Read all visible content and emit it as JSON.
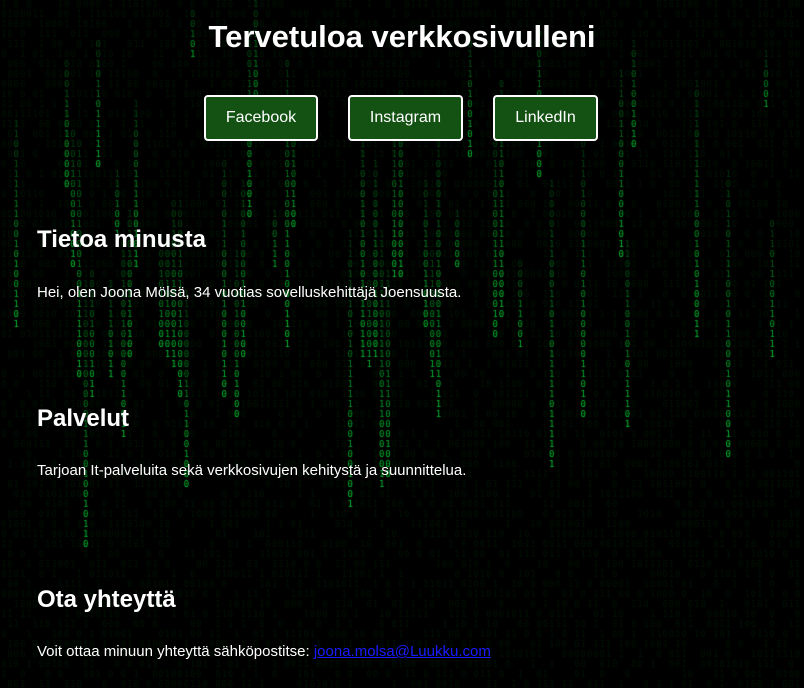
{
  "header": {
    "title": "Tervetuloa verkkosivulleni"
  },
  "nav": {
    "buttons": [
      {
        "label": "Facebook"
      },
      {
        "label": "Instagram"
      },
      {
        "label": "LinkedIn"
      }
    ]
  },
  "sections": {
    "about": {
      "heading": "Tietoa minusta",
      "text": "Hei, olen Joona Mölsä, 34 vuotias sovelluskehittäjä Joensuusta."
    },
    "services": {
      "heading": "Palvelut",
      "text": "Tarjoan It-palveluita sekä verkkosivujen kehitystä ja suunnittelua."
    },
    "contact": {
      "heading": "Ota yhteyttä",
      "text_prefix": "Voit ottaa minuun yhteyttä sähköpostitse: ",
      "email": "joona.molsa@Luukku.com"
    }
  },
  "theme": {
    "background": "#000000",
    "rain_color": "#00c832",
    "button_bg": "#145214",
    "link_color": "#1a1aff"
  }
}
